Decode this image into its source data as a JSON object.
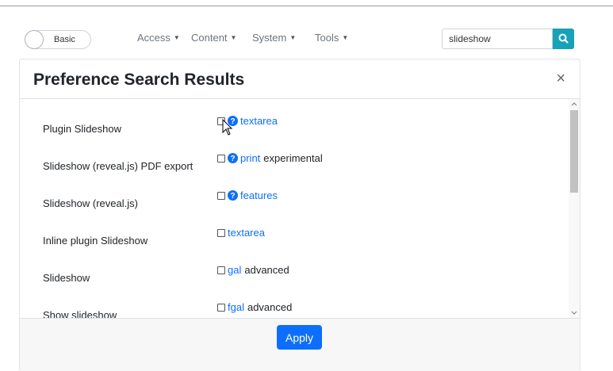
{
  "navbar": {
    "mode_toggle": {
      "label": "Basic",
      "checked": false
    },
    "menus": [
      {
        "label": "Access"
      },
      {
        "label": "Content"
      },
      {
        "label": "System"
      },
      {
        "label": "Tools"
      }
    ],
    "search": {
      "value": "slideshow",
      "button_icon": "search-icon"
    }
  },
  "modal": {
    "title": "Preference Search Results",
    "close_label": "×",
    "rows": [
      {
        "label": "Plugin Slideshow",
        "checked": false,
        "help_icon": true,
        "link": "textarea",
        "tag": ""
      },
      {
        "label": "Slideshow (reveal.js) PDF export",
        "checked": false,
        "help_icon": true,
        "link": "print",
        "tag": "experimental"
      },
      {
        "label": "Slideshow (reveal.js)",
        "checked": false,
        "help_icon": true,
        "link": "features",
        "tag": ""
      },
      {
        "label": "Inline plugin Slideshow",
        "checked": false,
        "help_icon": false,
        "link": "textarea",
        "tag": ""
      },
      {
        "label": "Slideshow",
        "checked": false,
        "help_icon": false,
        "link": "gal",
        "tag": "advanced"
      },
      {
        "label": "Show slideshow",
        "checked": false,
        "help_icon": false,
        "link": "fgal",
        "tag": "advanced"
      }
    ],
    "apply_label": "Apply"
  },
  "colors": {
    "primary": "#0d6efd",
    "search_button": "#17a2b8",
    "footer_bg": "#f7f7f7"
  }
}
